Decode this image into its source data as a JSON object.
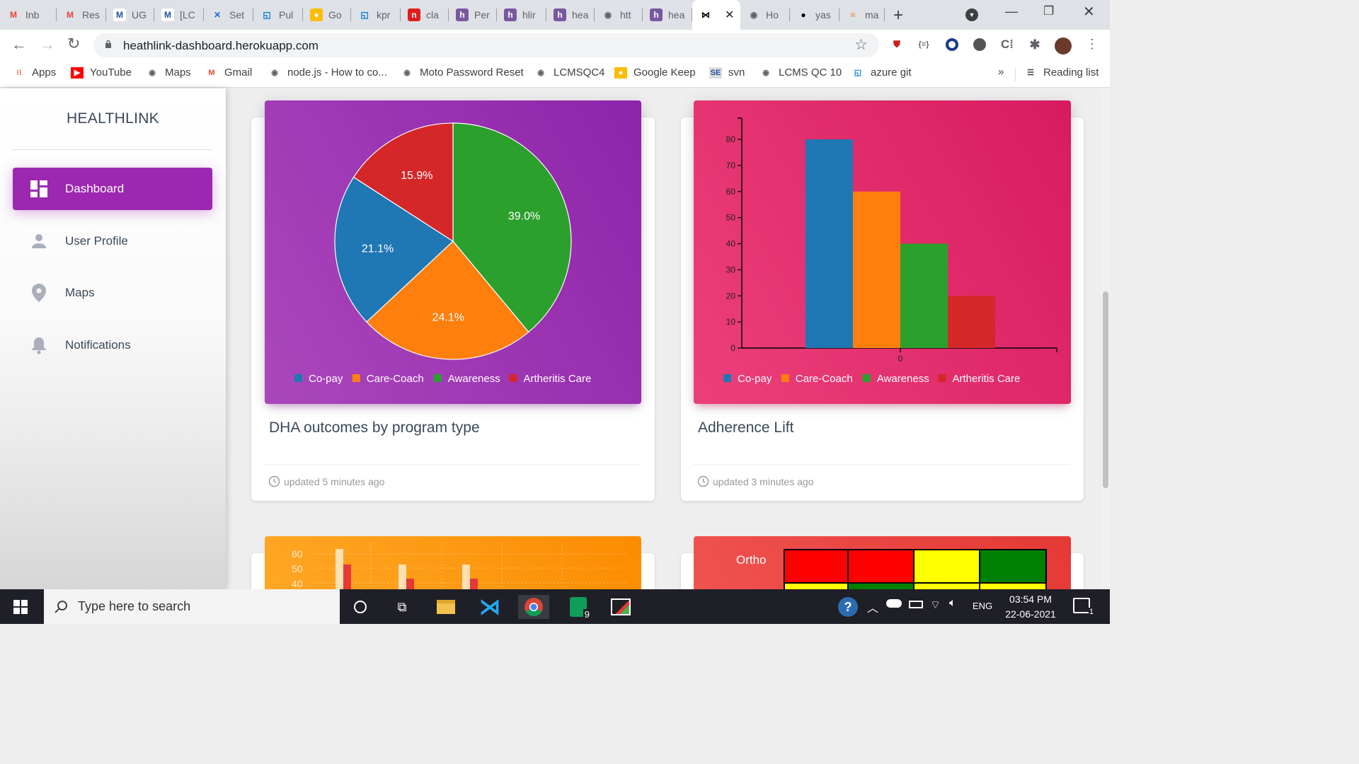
{
  "browser": {
    "tabs": [
      {
        "label": "Inb",
        "icon": "gmail-icon"
      },
      {
        "label": "Res",
        "icon": "gmail-icon"
      },
      {
        "label": "UG",
        "icon": "motorola-icon"
      },
      {
        "label": "[LC",
        "icon": "motorola-icon"
      },
      {
        "label": "Set",
        "icon": "confluence-icon"
      },
      {
        "label": "Pul",
        "icon": "azure-devops-icon"
      },
      {
        "label": "Go",
        "icon": "google-keep-icon"
      },
      {
        "label": "kpr",
        "icon": "azure-devops-icon"
      },
      {
        "label": "cla",
        "icon": "n-icon"
      },
      {
        "label": "Per",
        "icon": "heroku-icon"
      },
      {
        "label": "hlir",
        "icon": "heroku-icon"
      },
      {
        "label": "hea",
        "icon": "heroku-icon"
      },
      {
        "label": "htt",
        "icon": "globe-icon"
      },
      {
        "label": "hea",
        "icon": "heroku-icon"
      },
      {
        "label": "",
        "icon": "bowtie-icon",
        "active": true
      },
      {
        "label": "Ho",
        "icon": "globe-icon"
      },
      {
        "label": "yas",
        "icon": "github-icon"
      },
      {
        "label": "ma",
        "icon": "stackoverflow-icon"
      }
    ],
    "url": "heathlink-dashboard.herokuapp.com",
    "bookmarks": [
      {
        "label": "Apps",
        "icon": "apps-icon"
      },
      {
        "label": "YouTube",
        "icon": "youtube-icon"
      },
      {
        "label": "Maps",
        "icon": "globe-icon"
      },
      {
        "label": "Gmail",
        "icon": "gmail-icon"
      },
      {
        "label": "node.js - How to co...",
        "icon": "globe-icon"
      },
      {
        "label": "Moto Password Reset",
        "icon": "globe-icon"
      },
      {
        "label": "LCMSQC4",
        "icon": "globe-icon"
      },
      {
        "label": "Google Keep",
        "icon": "google-keep-icon"
      },
      {
        "label": "svn",
        "icon": "svn-icon"
      },
      {
        "label": "LCMS QC 10",
        "icon": "globe-icon"
      },
      {
        "label": "azure git",
        "icon": "azure-devops-icon"
      }
    ],
    "more_bookmarks": "»",
    "reading_list": "Reading list"
  },
  "sidebar": {
    "brand": "HEALTHLINK",
    "items": [
      {
        "label": "Dashboard",
        "icon": "dashboard-icon",
        "active": true
      },
      {
        "label": "User Profile",
        "icon": "person-icon"
      },
      {
        "label": "Maps",
        "icon": "location-pin-icon"
      },
      {
        "label": "Notifications",
        "icon": "bell-icon"
      }
    ]
  },
  "colors": {
    "purple": "#9c27b0",
    "pink": "#e91e63",
    "orange": "#ff9800",
    "red": "#f44336",
    "series": [
      "#1f77b4",
      "#ff7f0e",
      "#2ca02c",
      "#d62728"
    ]
  },
  "cards": [
    {
      "title": "DHA outcomes by program type",
      "footer": "updated 5 minutes ago",
      "chart_data": {
        "type": "pie",
        "categories": [
          "Co-pay",
          "Care-Coach",
          "Awareness",
          "Artheritis Care"
        ],
        "values": [
          21.1,
          24.1,
          39.0,
          15.9
        ],
        "labels": [
          "21.1%",
          "24.1%",
          "39.0%",
          "15.9%"
        ],
        "legend": "bottom"
      }
    },
    {
      "title": "Adherence Lift",
      "footer": "updated 3 minutes ago",
      "chart_data": {
        "type": "bar",
        "categories": [
          "Co-pay",
          "Care-Coach",
          "Awareness",
          "Artheritis Care"
        ],
        "x_ticks": [
          "0"
        ],
        "values": [
          80,
          60,
          40,
          20
        ],
        "y_ticks": [
          "0",
          "10",
          "20",
          "30",
          "40",
          "50",
          "60",
          "70",
          "80"
        ],
        "ylim": [
          0,
          88
        ],
        "legend": "bottom"
      }
    }
  ],
  "partial": {
    "bar_chart_yticks": [
      "60",
      "50",
      "40"
    ],
    "heatmap_label": "Ortho"
  },
  "taskbar": {
    "search_placeholder": "Type here to search",
    "language": "ENG",
    "time": "03:54 PM",
    "date": "22-06-2021",
    "notification_count": "1",
    "sheets_badge": "9"
  }
}
